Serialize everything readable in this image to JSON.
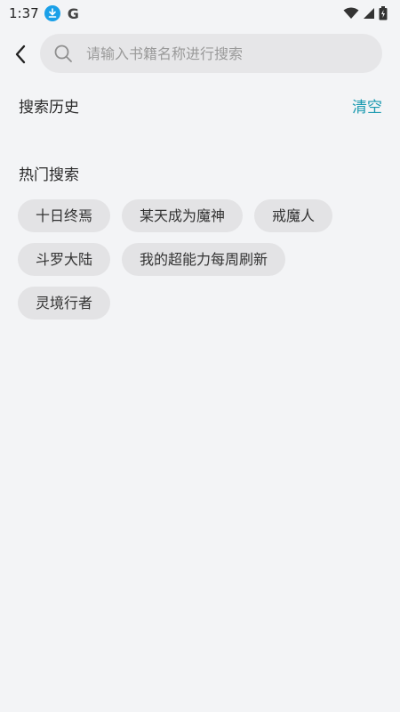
{
  "status_bar": {
    "time": "1:37",
    "g_letter": "G"
  },
  "search": {
    "placeholder": "请输入书籍名称进行搜索"
  },
  "history": {
    "title": "搜索历史",
    "clear_label": "清空"
  },
  "hot": {
    "title": "热门搜索",
    "tags": [
      "十日终焉",
      "某天成为魔神",
      "戒魔人",
      "斗罗大陆",
      "我的超能力每周刷新",
      "灵境行者"
    ]
  },
  "colors": {
    "accent": "#1b9ab0",
    "download_badge": "#1aa0e8",
    "background": "#f3f4f6"
  },
  "icons": [
    "download-icon",
    "wifi-icon",
    "signal-icon",
    "battery-icon",
    "back-arrow-icon",
    "search-icon"
  ]
}
